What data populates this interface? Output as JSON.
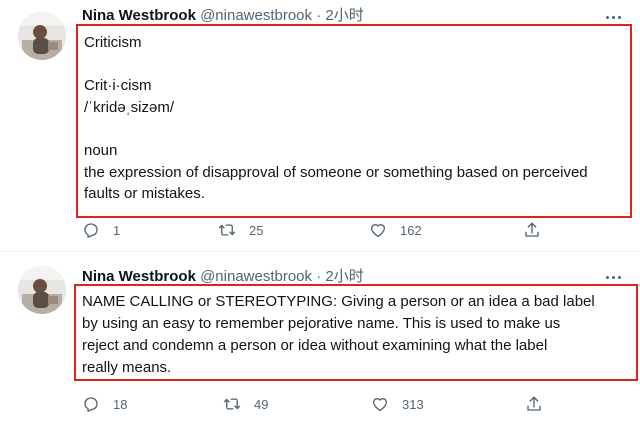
{
  "tweets": [
    {
      "author_name": "Nina Westbrook",
      "handle": "@ninawestbrook",
      "separator": "·",
      "time": "2小时",
      "lines": [
        "Criticism",
        "",
        "Crit·i·cism",
        "/ˈkridəˌsizəm/",
        "",
        "noun",
        "the expression of disapproval of someone or something based on perceived",
        "faults or mistakes."
      ],
      "reply_count": "1",
      "retweet_count": "25",
      "like_count": "162"
    },
    {
      "author_name": "Nina Westbrook",
      "handle": "@ninawestbrook",
      "separator": "·",
      "time": "2小时",
      "lines": [
        "NAME CALLING or STEREOTYPING: Giving a person or an idea a bad label",
        "by using an easy to remember pejorative name. This is used to make us",
        "reject and condemn a person or idea without examining what the label",
        "really means."
      ],
      "reply_count": "18",
      "retweet_count": "49",
      "like_count": "313"
    }
  ],
  "icons": {
    "reply": "reply-icon",
    "retweet": "retweet-icon",
    "like": "heart-icon",
    "share": "share-icon",
    "more": "more-icon"
  },
  "colors": {
    "highlight_border": "#e0231f",
    "text_primary": "#0f1419",
    "text_secondary": "#536471"
  }
}
